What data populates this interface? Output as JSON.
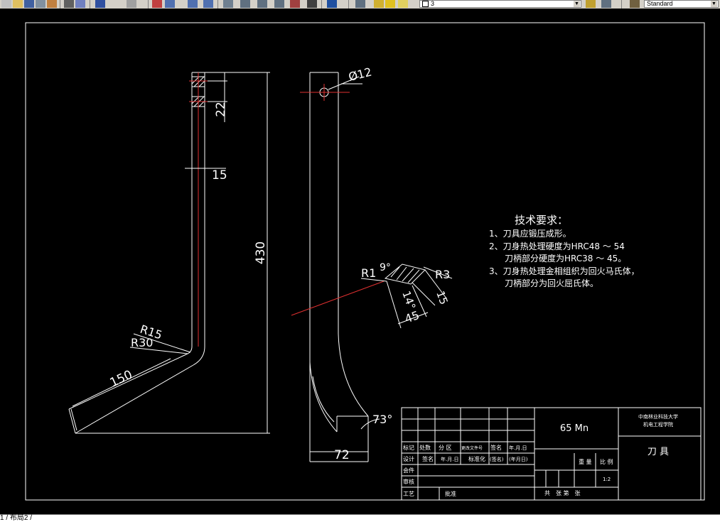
{
  "toolbar": {
    "layer_value": "3",
    "style_value": "Standard"
  },
  "drawing": {
    "dims": {
      "hole_spacing": "22",
      "thickness": "15",
      "height": "430",
      "radius_outer": "R15",
      "radius_inner": "R30",
      "blade_length": "150",
      "hole_dia": "Ø12",
      "section_r1": "R1",
      "section_angle_top": "9°",
      "section_r3": "R3",
      "section_angle_side": "14°",
      "section_width": "45",
      "section_thick": "15",
      "base_width": "72",
      "tip_angle": "73°"
    },
    "requirements": {
      "title": "技术要求：",
      "lines": [
        "1、刀具应锻压成形。",
        "2、刀身热处理硬度为HRC48 ～ 54",
        "刀柄部分硬度为HRC38 ～ 45。",
        "3、刀身热处理金相组织为回火马氏体，",
        "刀柄部分为回火屈氏体。"
      ]
    },
    "title_block": {
      "material": "65 Mn",
      "school_line1": "中南林业科技大学",
      "school_line2": "机电工程学院",
      "part_name": "刀 具",
      "row_labels": [
        "标记",
        "处数",
        "分 区",
        "更改文件号",
        "签名",
        "年.月.日"
      ],
      "design_labels": [
        "设计",
        "签名",
        "年.月.日",
        "标准化",
        "(签名)",
        "(年月日)"
      ],
      "left_labels": [
        "会件",
        "审核",
        "工艺"
      ],
      "approve": "批准",
      "weight_label": "重 量",
      "scale_label": "比 例",
      "scale_value": "1:2",
      "sheets_label": "共　张 第　张"
    }
  },
  "status": {
    "layout_tab": "1 / 布局2 /"
  }
}
